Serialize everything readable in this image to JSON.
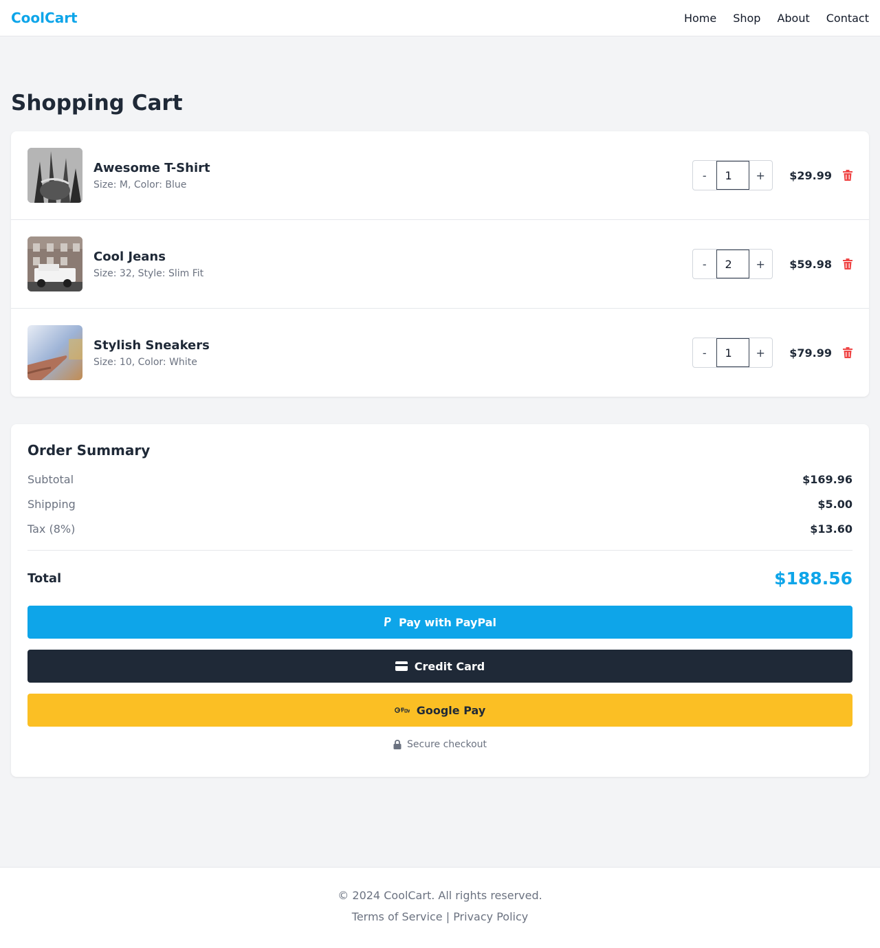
{
  "brand": {
    "name": "CoolCart",
    "accent": "#0ea5e9"
  },
  "nav": {
    "items": [
      "Home",
      "Shop",
      "About",
      "Contact"
    ]
  },
  "page": {
    "title": "Shopping Cart"
  },
  "cart": {
    "items": [
      {
        "name": "Awesome T-Shirt",
        "desc": "Size: M, Color: Blue",
        "qty": "1",
        "price": "$29.99",
        "thumb": "cactus-photo"
      },
      {
        "name": "Cool Jeans",
        "desc": "Size: 32, Style: Slim Fit",
        "qty": "2",
        "price": "$59.98",
        "thumb": "white-truck-photo"
      },
      {
        "name": "Stylish Sneakers",
        "desc": "Size: 10, Color: White",
        "qty": "1",
        "price": "$79.99",
        "thumb": "hand-photo"
      }
    ],
    "minus_label": "-",
    "plus_label": "+"
  },
  "summary": {
    "title": "Order Summary",
    "rows": [
      {
        "label": "Subtotal",
        "value": "$169.96"
      },
      {
        "label": "Shipping",
        "value": "$5.00"
      },
      {
        "label": "Tax (8%)",
        "value": "$13.60"
      }
    ],
    "total_label": "Total",
    "total_value": "$188.56",
    "buttons": {
      "paypal": "Pay with PayPal",
      "card": "Credit Card",
      "gpay": "Google Pay"
    },
    "secure": "Secure checkout"
  },
  "footer": {
    "copyright": "© 2024 CoolCart. All rights reserved.",
    "terms": "Terms of Service",
    "separator": "|",
    "privacy": "Privacy Policy"
  },
  "colors": {
    "danger": "#ef4444",
    "dark": "#1f2937",
    "gpay": "#fbbf24"
  }
}
